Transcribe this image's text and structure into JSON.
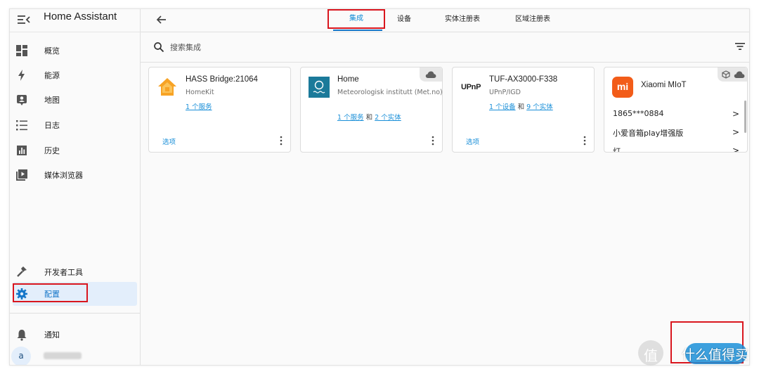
{
  "app": {
    "title": "Home Assistant"
  },
  "sidebar": {
    "items": [
      {
        "label": "概览",
        "icon": "dashboard-icon"
      },
      {
        "label": "能源",
        "icon": "lightning-icon"
      },
      {
        "label": "地图",
        "icon": "map-icon"
      },
      {
        "label": "日志",
        "icon": "logbook-icon"
      },
      {
        "label": "历史",
        "icon": "history-chart-icon"
      },
      {
        "label": "媒体浏览器",
        "icon": "media-play-icon"
      }
    ],
    "bottom_items": [
      {
        "label": "开发者工具",
        "icon": "hammer-icon"
      },
      {
        "label": "配置",
        "icon": "gear-icon"
      }
    ],
    "notifications_label": "通知",
    "avatar_initial": "a"
  },
  "tabs": [
    {
      "label": "集成"
    },
    {
      "label": "设备"
    },
    {
      "label": "实体注册表"
    },
    {
      "label": "区域注册表"
    }
  ],
  "search": {
    "placeholder": "搜索集成"
  },
  "cards": [
    {
      "title": "HASS Bridge:21064",
      "subtitle": "HomeKit",
      "link1": "1 个服务",
      "option_label": "选项"
    },
    {
      "title": "Home",
      "subtitle": "Meteorologisk institutt (Met.no)",
      "link1": "1 个服务",
      "joiner": "和",
      "link2": "2 个实体"
    },
    {
      "title": "TUF-AX3000-F338",
      "subtitle": "UPnP/IGD",
      "logo_text": "UPnP",
      "link1": "1 个设备",
      "joiner": "和",
      "link2": "9 个实体",
      "option_label": "选项"
    },
    {
      "title": "Xiaomi MIoT",
      "logo_text": "mi",
      "entries": [
        "1865***0884",
        "小爱音箱play增强版",
        "灯"
      ]
    }
  ],
  "watermark": {
    "glyph": "值",
    "text": "什么值得买"
  },
  "colors": {
    "accent": "#1a8fd8",
    "active_bg": "#e3eefb",
    "highlight": "#d9161e",
    "homekit": "#f7a325",
    "met": "#1b7a9a",
    "xiaomi": "#f25c19"
  }
}
